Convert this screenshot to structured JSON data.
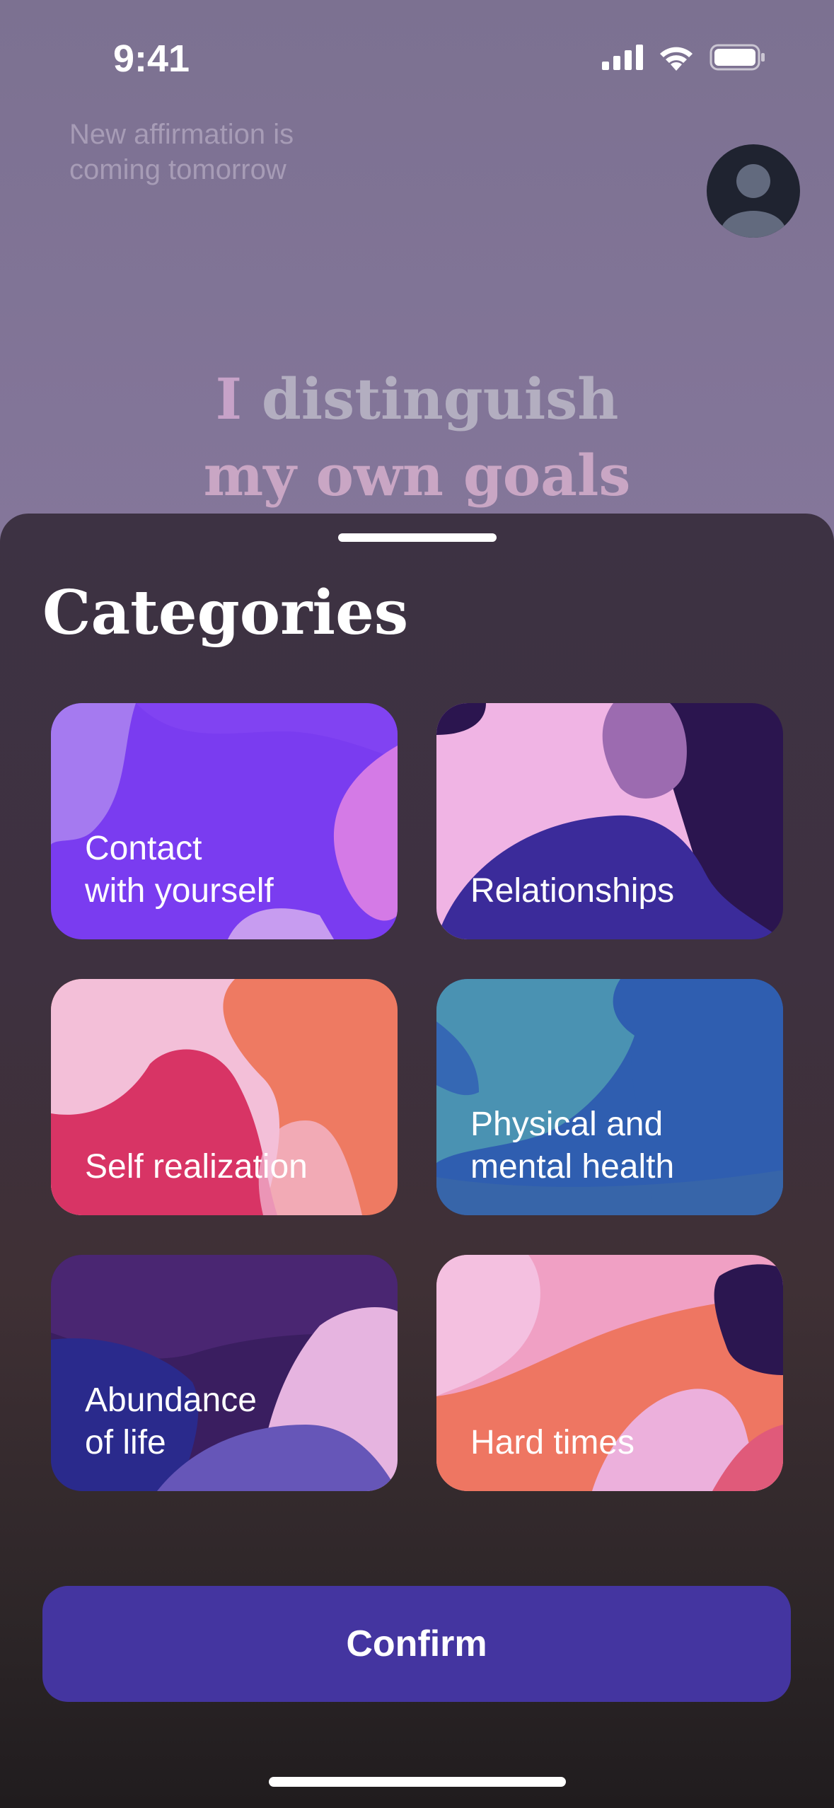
{
  "status_bar": {
    "time": "9:41"
  },
  "header": {
    "hint": "New affirmation is coming tomorrow"
  },
  "affirmation": {
    "word1": "I",
    "line1_rest": " distinguish",
    "line2": "my own goals"
  },
  "sheet": {
    "title": "Categories",
    "categories": [
      {
        "label": "Contact with yourself",
        "line1": "Contact",
        "line2": "with yourself"
      },
      {
        "label": "Relationships",
        "line1": "Relationships",
        "line2": ""
      },
      {
        "label": "Self realization",
        "line1": "Self realization",
        "line2": ""
      },
      {
        "label": "Physical and mental health",
        "line1": "Physical and",
        "line2": "mental health"
      },
      {
        "label": "Abundance of life",
        "line1": "Abundance",
        "line2": "of life"
      },
      {
        "label": "Hard times",
        "line1": "Hard times",
        "line2": ""
      }
    ],
    "confirm_label": "Confirm"
  },
  "icons": [
    "signal-icon",
    "wifi-icon",
    "battery-icon",
    "avatar-icon"
  ]
}
